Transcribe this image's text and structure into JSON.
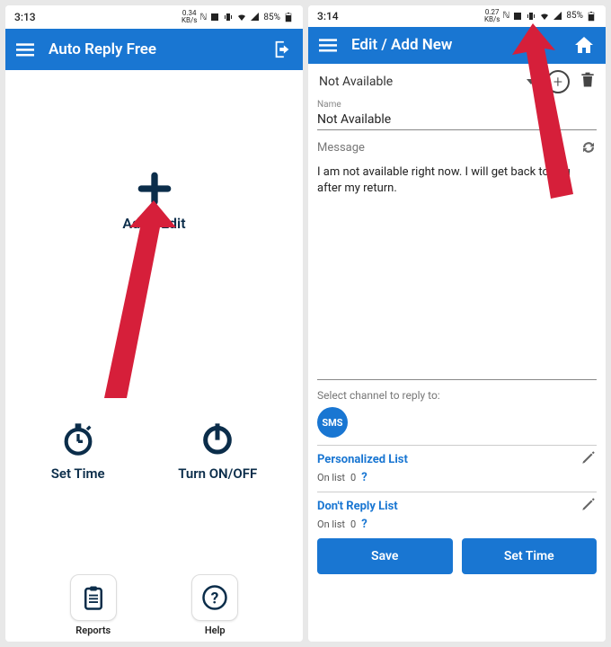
{
  "colors": {
    "primary": "#1976d2",
    "navy": "#0b2d4a",
    "arrow": "#d61f3a"
  },
  "status": {
    "left": {
      "time": "3:13",
      "kbps": "0.34",
      "kbps_unit": "KB/s"
    },
    "right": {
      "time": "3:14",
      "kbps": "0.27",
      "kbps_unit": "KB/s"
    },
    "battery": "85%"
  },
  "screen1": {
    "title": "Auto Reply Free",
    "add_edit": {
      "label": "Add / Edit"
    },
    "set_time": {
      "label": "Set Time"
    },
    "toggle": {
      "label": "Turn ON/OFF"
    },
    "reports": {
      "label": "Reports"
    },
    "help": {
      "label": "Help"
    }
  },
  "screen2": {
    "title": "Edit / Add New",
    "dropdown_value": "Not Available",
    "name_label": "Name",
    "name_value": "Not Available",
    "message_label": "Message",
    "message_value": "I am not available right now. I will get back to you after my return.",
    "select_channel_label": "Select channel to reply to:",
    "sms_badge": "SMS",
    "personalized": {
      "title": "Personalized List",
      "onlist_prefix": "On list",
      "count": "0"
    },
    "dontreply": {
      "title": "Don't Reply List",
      "onlist_prefix": "On list",
      "count": "0"
    },
    "save_label": "Save",
    "settime_label": "Set Time"
  }
}
